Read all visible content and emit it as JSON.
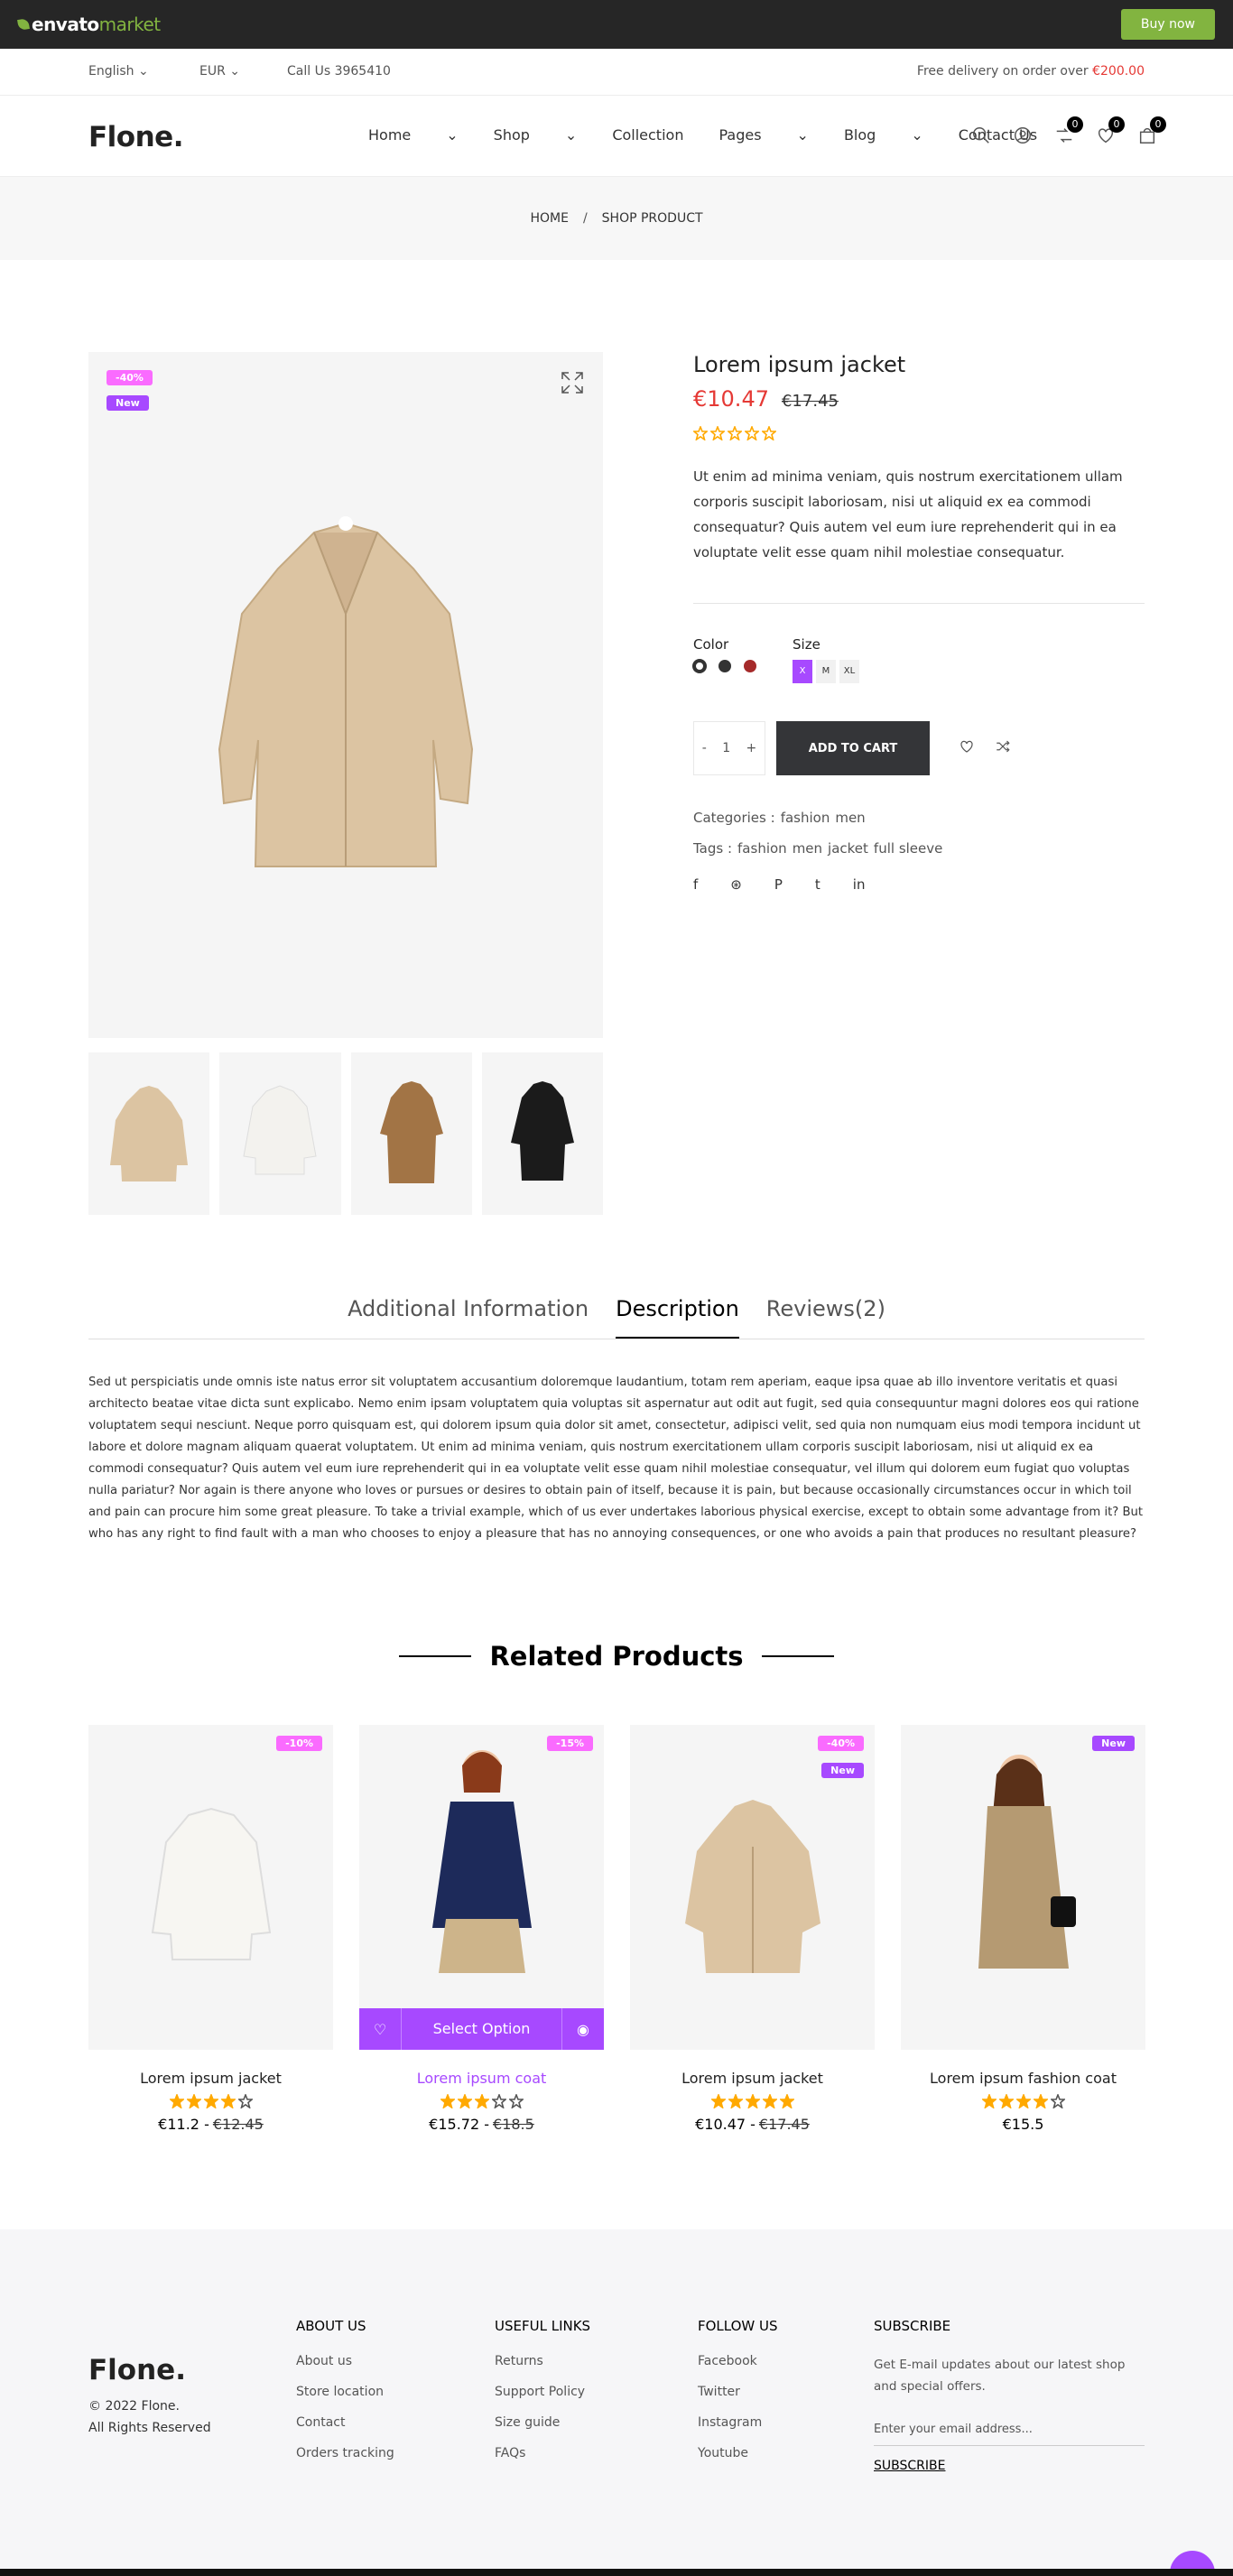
{
  "envato": {
    "brand_a": "envato",
    "brand_b": "market",
    "buy_now": "Buy now"
  },
  "header_top": {
    "language": "English",
    "currency": "EUR",
    "phone": "Call Us 3965410",
    "free_delivery": "Free delivery on order over ",
    "free_delivery_price": "€200.00"
  },
  "nav": {
    "logo": "Flone.",
    "links": [
      "Home",
      "Shop",
      "Collection",
      "Pages",
      "Blog",
      "Contact Us"
    ],
    "compare_count": "0",
    "wishlist_count": "0",
    "cart_count": "0"
  },
  "breadcrumb": {
    "home": "HOME",
    "sep": "/",
    "current": "SHOP PRODUCT"
  },
  "product": {
    "badge_sale": "-40%",
    "badge_new": "New",
    "title": "Lorem ipsum jacket",
    "price": "€10.47",
    "old_price": "€17.45",
    "rating": 0,
    "description": "Ut enim ad minima veniam, quis nostrum exercitationem ullam corporis suscipit laboriosam, nisi ut aliquid ex ea commodi consequatur? Quis autem vel eum iure reprehenderit qui in ea voluptate velit esse quam nihil molestiae consequatur.",
    "color_label": "Color",
    "size_label": "Size",
    "colors": [
      "#ffffff",
      "#333333",
      "#a52a2a"
    ],
    "sizes": [
      "X",
      "M",
      "XL"
    ],
    "qty_minus": "-",
    "qty": "1",
    "qty_plus": "+",
    "add_to_cart": "ADD TO CART",
    "categories_label": "Categories :",
    "categories": [
      "fashion",
      "men"
    ],
    "tags_label": "Tags :",
    "tags": [
      "fashion",
      "men",
      "jacket",
      "full sleeve"
    ],
    "social": [
      "f",
      "⊛",
      "P",
      "t",
      "in"
    ]
  },
  "tabs": {
    "additional": "Additional Information",
    "description": "Description",
    "reviews": "Reviews(2)"
  },
  "long_description": "Sed ut perspiciatis unde omnis iste natus error sit voluptatem accusantium doloremque laudantium, totam rem aperiam, eaque ipsa quae ab illo inventore veritatis et quasi architecto beatae vitae dicta sunt explicabo. Nemo enim ipsam voluptatem quia voluptas sit aspernatur aut odit aut fugit, sed quia consequuntur magni dolores eos qui ratione voluptatem sequi nesciunt. Neque porro quisquam est, qui dolorem ipsum quia dolor sit amet, consectetur, adipisci velit, sed quia non numquam eius modi tempora incidunt ut labore et dolore magnam aliquam quaerat voluptatem. Ut enim ad minima veniam, quis nostrum exercitationem ullam corporis suscipit laboriosam, nisi ut aliquid ex ea commodi consequatur? Quis autem vel eum iure reprehenderit qui in ea voluptate velit esse quam nihil molestiae consequatur, vel illum qui dolorem eum fugiat quo voluptas nulla pariatur? Nor again is there anyone who loves or pursues or desires to obtain pain of itself, because it is pain, but because occasionally circumstances occur in which toil and pain can procure him some great pleasure. To take a trivial example, which of us ever undertakes laborious physical exercise, except to obtain some advantage from it? But who has any right to find fault with a man who chooses to enjoy a pleasure that has no annoying consequences, or one who avoids a pain that produces no resultant pleasure?",
  "related": {
    "title": "Related Products",
    "items": [
      {
        "name": "Lorem ipsum jacket",
        "price": "€11.2 -",
        "old": "€12.45",
        "badge": "-10%",
        "badge2": "",
        "rating": 4
      },
      {
        "name": "Lorem ipsum coat",
        "price": "€15.72 -",
        "old": "€18.5",
        "badge": "-15%",
        "badge2": "",
        "rating": 3,
        "select_option": "Select Option"
      },
      {
        "name": "Lorem ipsum jacket",
        "price": "€10.47 -",
        "old": "€17.45",
        "badge": "-40%",
        "badge2": "New",
        "rating": 5
      },
      {
        "name": "Lorem ipsum fashion coat",
        "price": "€15.5",
        "old": "",
        "badge": "",
        "badge2": "New",
        "rating": 4
      }
    ]
  },
  "footer": {
    "logo": "Flone.",
    "copy1": "© 2022 Flone.",
    "copy2": "All Rights Reserved",
    "about": {
      "h": "ABOUT US",
      "links": [
        "About us",
        "Store location",
        "Contact",
        "Orders tracking"
      ]
    },
    "useful": {
      "h": "USEFUL LINKS",
      "links": [
        "Returns",
        "Support Policy",
        "Size guide",
        "FAQs"
      ]
    },
    "follow": {
      "h": "FOLLOW US",
      "links": [
        "Facebook",
        "Twitter",
        "Instagram",
        "Youtube"
      ]
    },
    "subscribe": {
      "h": "SUBSCRIBE",
      "desc": "Get E-mail updates about our latest shop and special offers.",
      "placeholder": "Enter your email address...",
      "button": "SUBSCRIBE"
    }
  },
  "colors": {
    "accent": "#a749ff",
    "sale": "#fa6bff",
    "price_red": "#e53935"
  }
}
